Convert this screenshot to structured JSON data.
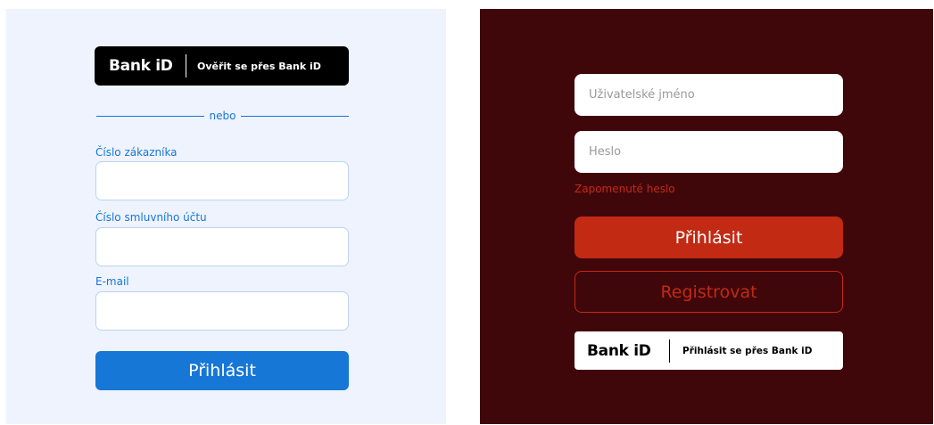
{
  "left": {
    "bankid_logo": "Bank iD",
    "bankid_label": "Ověřit se přes Bank iD",
    "or_text": "nebo",
    "customer_number_label": "Číslo zákazníka",
    "contract_account_label": "Číslo smluvního účtu",
    "email_label": "E-mail",
    "login_button": "Přihlásit",
    "accent_color": "#1677d6",
    "background_color": "#eef3fe"
  },
  "right": {
    "username_placeholder": "Uživatelské jméno",
    "password_placeholder": "Heslo",
    "forgot_password": "Zapomenuté heslo",
    "login_button": "Přihlásit",
    "register_button": "Registrovat",
    "bankid_logo": "Bank iD",
    "bankid_label": "Přihlásit se přes Bank iD",
    "accent_color": "#c22a14",
    "background_color": "#40070b"
  }
}
